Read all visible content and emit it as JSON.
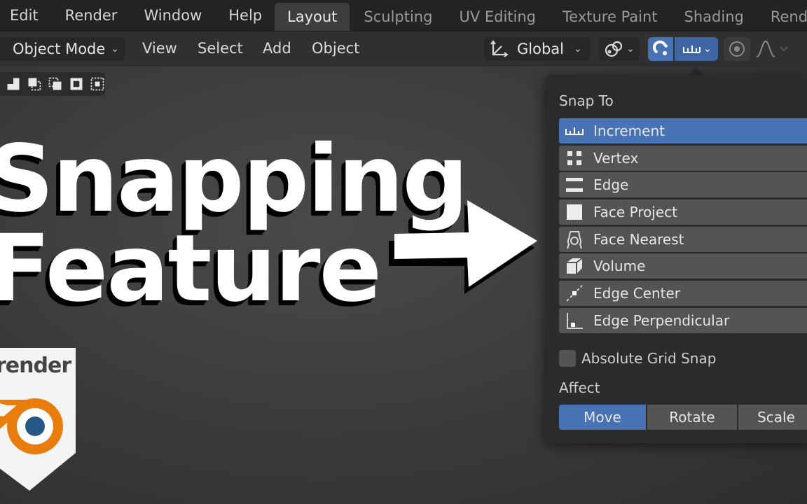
{
  "menubar": {
    "items": [
      "Edit",
      "Render",
      "Window",
      "Help"
    ],
    "workspace_tabs": [
      "Layout",
      "Sculpting",
      "UV Editing",
      "Texture Paint",
      "Shading",
      "Rend"
    ]
  },
  "header": {
    "mode": "Object Mode",
    "menus": [
      "View",
      "Select",
      "Add",
      "Object"
    ],
    "transform_orientation": "Global"
  },
  "thumbnail": {
    "title_line1": "Snapping",
    "title_line2": "Feature",
    "badge_text": "render"
  },
  "snap_popup": {
    "snap_to_label": "Snap To",
    "items": [
      {
        "label": "Increment",
        "icon": "increment-icon",
        "active": true
      },
      {
        "label": "Vertex",
        "icon": "vertex-icon",
        "active": false
      },
      {
        "label": "Edge",
        "icon": "edge-icon",
        "active": false
      },
      {
        "label": "Face Project",
        "icon": "face-project-icon",
        "active": false
      },
      {
        "label": "Face Nearest",
        "icon": "face-nearest-icon",
        "active": false
      },
      {
        "label": "Volume",
        "icon": "volume-icon",
        "active": false
      },
      {
        "label": "Edge Center",
        "icon": "edge-center-icon",
        "active": false
      },
      {
        "label": "Edge Perpendicular",
        "icon": "edge-perpendicular-icon",
        "active": false
      }
    ],
    "absolute_grid_snap": "Absolute Grid Snap",
    "affect_label": "Affect",
    "affect_options": [
      "Move",
      "Rotate",
      "Scale"
    ],
    "affect_active": "Move"
  },
  "colors": {
    "accent_blue": "#4772b3",
    "blender_orange": "#e87d0d",
    "blender_blue": "#265787"
  }
}
